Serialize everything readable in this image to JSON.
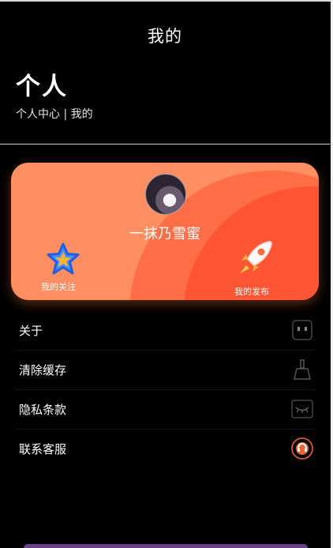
{
  "header": {
    "title": "我的"
  },
  "hero": {
    "title": "个人",
    "subtitle": "个人中心 | 我的"
  },
  "profile": {
    "username": "一抹乃雪蜜",
    "actions": [
      {
        "label": "我的关注",
        "icon": "star-icon"
      },
      {
        "label": "我的发布",
        "icon": "rocket-icon"
      }
    ]
  },
  "menu": [
    {
      "label": "关于",
      "icon": "robot-icon"
    },
    {
      "label": "清除缓存",
      "icon": "broom-icon"
    },
    {
      "label": "隐私条款",
      "icon": "closed-eye-icon"
    },
    {
      "label": "联系客服",
      "icon": "headset-icon"
    }
  ],
  "colors": {
    "card": "#ff8f62",
    "card_dark": "#ff5535",
    "star": "#1f6fff",
    "rocket": "#ff6a3d"
  }
}
